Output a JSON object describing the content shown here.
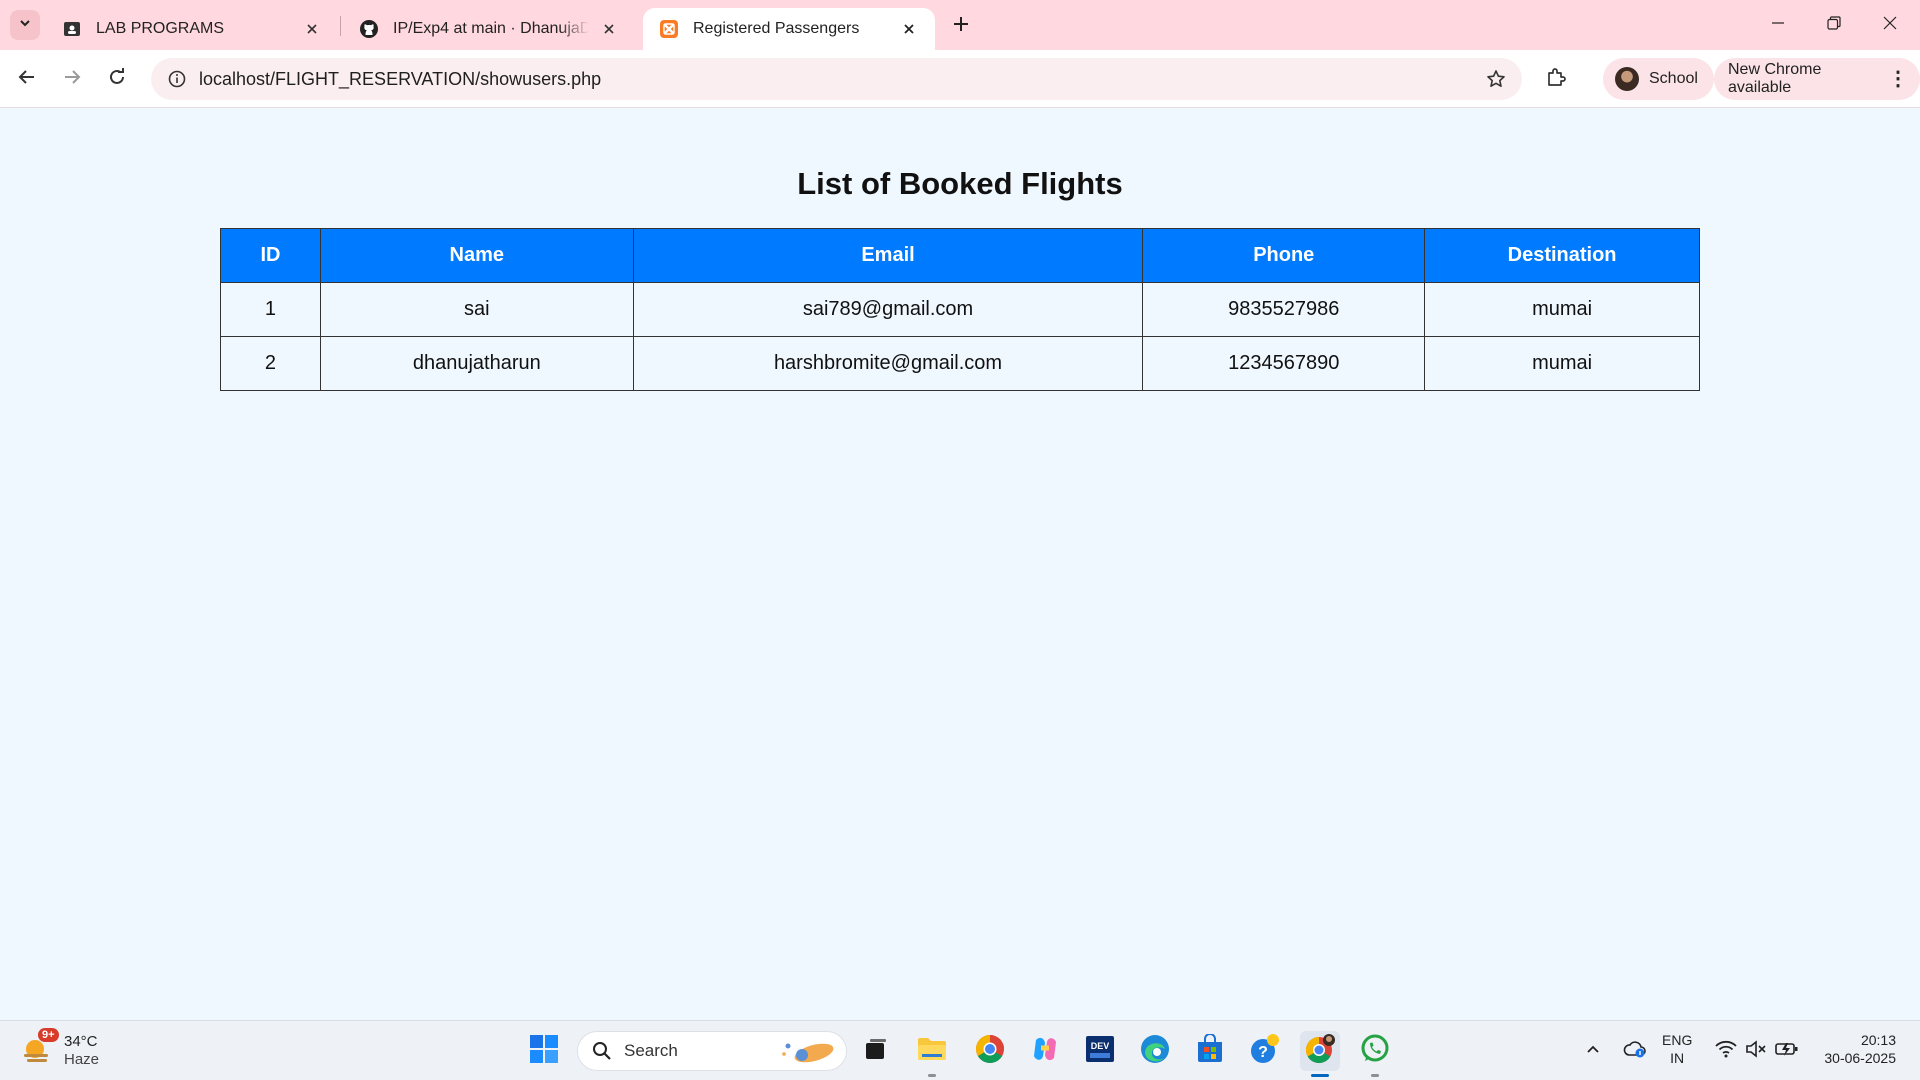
{
  "browser": {
    "tabs": [
      {
        "title": "LAB PROGRAMS",
        "active": false
      },
      {
        "title": "IP/Exp4 at main · DhanujaDhanu",
        "active": false
      },
      {
        "title": "Registered Passengers",
        "active": true
      }
    ],
    "url": "localhost/FLIGHT_RESERVATION/showusers.php",
    "profile_label": "School",
    "update_label": "New Chrome available"
  },
  "page": {
    "heading": "List of Booked Flights",
    "table": {
      "headers": [
        "ID",
        "Name",
        "Email",
        "Phone",
        "Destination"
      ],
      "rows": [
        [
          "1",
          "sai",
          "sai789@gmail.com",
          "9835527986",
          "mumai"
        ],
        [
          "2",
          "dhanujatharun",
          "harshbromite@gmail.com",
          "1234567890",
          "mumai"
        ]
      ]
    }
  },
  "taskbar": {
    "weather": {
      "temp": "34°C",
      "condition": "Haze",
      "badge": "9+"
    },
    "search_placeholder": "Search",
    "language": {
      "line1": "ENG",
      "line2": "IN"
    },
    "clock": {
      "time": "20:13",
      "date": "30-06-2025"
    }
  },
  "colors": {
    "header_blue": "#007bff",
    "page_bg": "#f0f8ff",
    "tabstrip_pink": "#ffd9df"
  }
}
